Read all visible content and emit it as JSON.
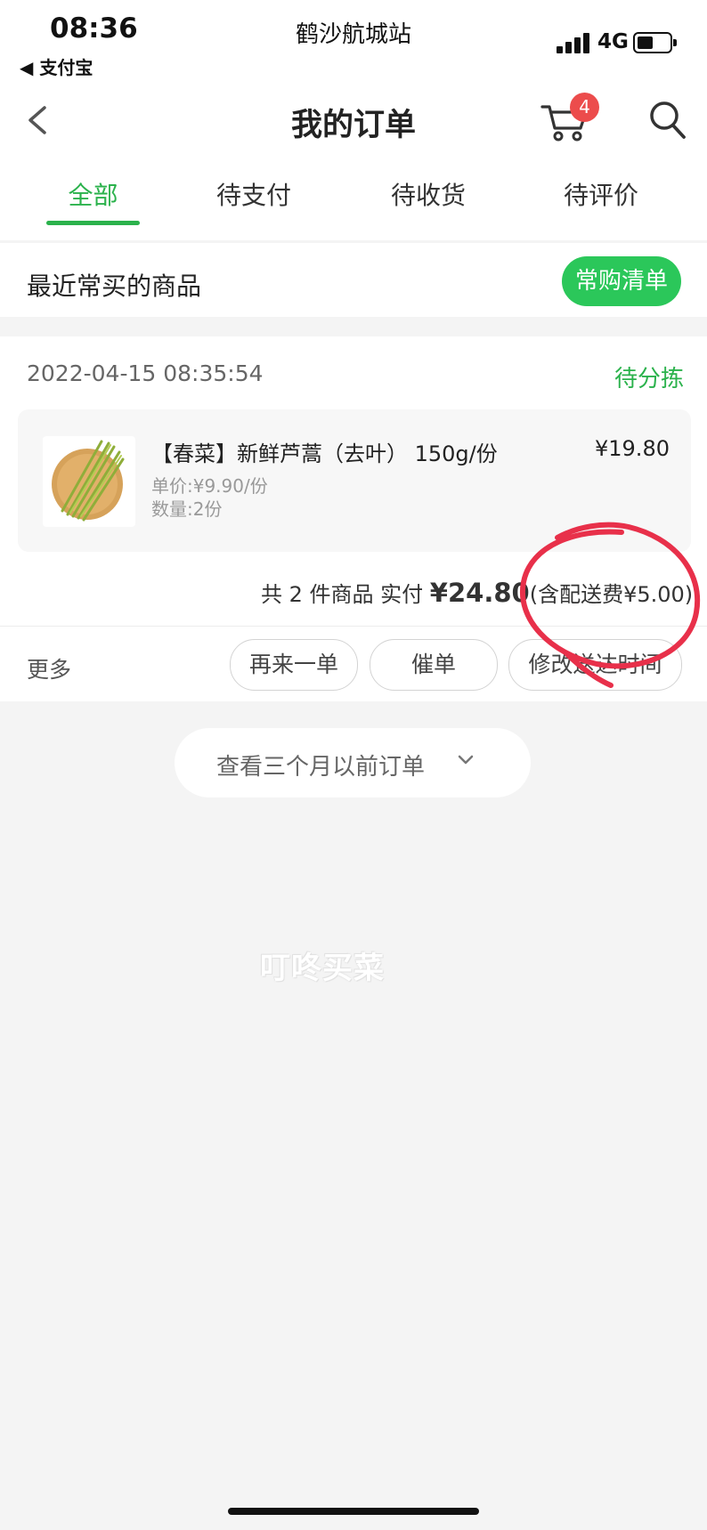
{
  "status_bar": {
    "time": "08:36",
    "back_app": "◀ 支付宝",
    "location": "鹤沙航城站",
    "network": "4G",
    "battery_level": 0.55
  },
  "header": {
    "title": "我的订单",
    "cart_count": "4",
    "icons": [
      "back-chevron-icon",
      "cart-icon",
      "search-icon"
    ]
  },
  "tabs": [
    {
      "label": "全部",
      "active": true
    },
    {
      "label": "待支付",
      "active": false
    },
    {
      "label": "待收货",
      "active": false
    },
    {
      "label": "待评价",
      "active": false
    }
  ],
  "recent": {
    "label": "最近常买的商品",
    "button": "常购清单"
  },
  "order": {
    "time": "2022-04-15 08:35:54",
    "status": "待分拣",
    "item": {
      "title": "【春菜】新鲜芦蒿（去叶） 150g/份",
      "price": "¥19.80",
      "unit_price": "单价:¥9.90/份",
      "quantity": "数量:2份"
    },
    "summary": {
      "prefix": "共 2 件商品 实付",
      "total": "¥24.80",
      "delivery": "(含配送费¥5.00)"
    },
    "more": "更多",
    "actions": [
      "再来一单",
      "催单",
      "修改送达时间"
    ]
  },
  "earlier_orders": "查看三个月以前订单",
  "watermark": "叮咚买菜",
  "colors": {
    "accent_green": "#2bb24c",
    "button_green": "#2bc75a",
    "badge_red": "#ec4c4c",
    "annotation_red": "#e8304a"
  }
}
